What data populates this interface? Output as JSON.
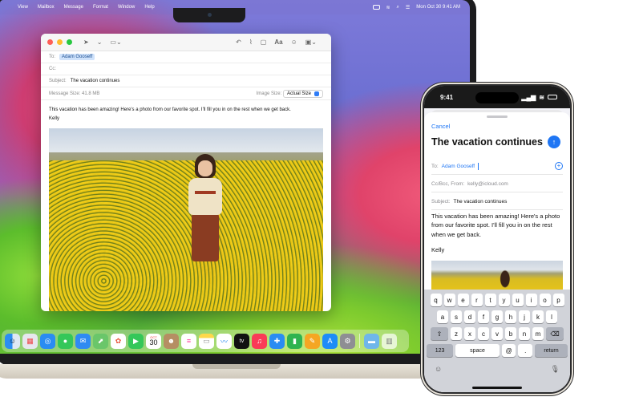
{
  "mac": {
    "menubar": {
      "items": [
        "View",
        "Mailbox",
        "Message",
        "Format",
        "Window",
        "Help"
      ],
      "clock": "Mon Oct 30  9:41 AM"
    },
    "mail": {
      "to_label": "To:",
      "to_value": "Adam Gooseff",
      "cc_label": "Cc:",
      "subject_label": "Subject:",
      "subject_value": "The vacation continues",
      "message_size_label": "Message Size:",
      "message_size_value": "41.8 MB",
      "image_size_label": "Image Size:",
      "image_size_value": "Actual Size",
      "body_text": "This vacation has been amazing! Here's a photo from our favorite spot. I'll fill you in on the rest when we get back.",
      "signature": "Kelly"
    },
    "dock": {
      "calendar_month": "OCT",
      "calendar_day": "30",
      "tv_label": "tv"
    }
  },
  "phone": {
    "time": "9:41",
    "cancel_label": "Cancel",
    "subject_title": "The vacation continues",
    "to_label": "To:",
    "to_value": "Adam Gooseff",
    "ccbcc_label": "Cc/Bcc, From:",
    "from_value": "kelly@icloud.com",
    "subject_label": "Subject:",
    "subject_value": "The vacation continues",
    "body_text": "This vacation has been amazing! Here's a photo from our favorite spot. I'll fill you in on the rest when we get back.",
    "signature": "Kelly",
    "keyboard": {
      "row1": [
        "q",
        "w",
        "e",
        "r",
        "t",
        "y",
        "u",
        "i",
        "o",
        "p"
      ],
      "row2": [
        "a",
        "s",
        "d",
        "f",
        "g",
        "h",
        "j",
        "k",
        "l"
      ],
      "row3": [
        "z",
        "x",
        "c",
        "v",
        "b",
        "n",
        "m"
      ],
      "numbers_key": "123",
      "space_key": "space",
      "at_key": "@",
      "dot_key": ".",
      "return_key": "return"
    }
  },
  "colors": {
    "accent_blue": "#1f76f4",
    "recipient_chip": "#cfe2fb"
  }
}
